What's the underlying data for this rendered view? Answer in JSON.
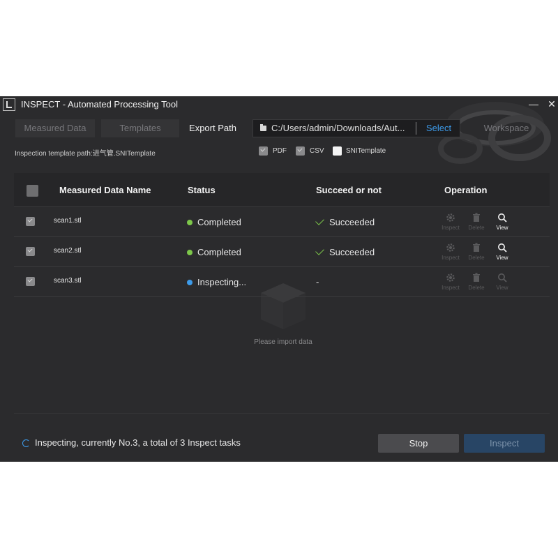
{
  "window": {
    "title": "INSPECT - Automated Processing Tool",
    "minimize_glyph": "—",
    "close_glyph": "✕"
  },
  "tabs": [
    {
      "label": "Measured Data",
      "active": false
    },
    {
      "label": "Templates",
      "active": false
    },
    {
      "label": "Export Path",
      "active": true
    },
    {
      "label": "Workspace",
      "active": false
    }
  ],
  "export": {
    "path_value": "C:/Users/admin/Downloads/Aut...",
    "select_label": "Select",
    "template_path_label": "Inspection template path:进气管.SNITemplate",
    "formats": [
      {
        "label": "PDF",
        "checked": true
      },
      {
        "label": "CSV",
        "checked": true
      },
      {
        "label": "SNITemplate",
        "checked": false
      }
    ]
  },
  "table": {
    "headers": {
      "name": "Measured Data Name",
      "status": "Status",
      "result": "Succeed or not",
      "operation": "Operation"
    },
    "rows": [
      {
        "name": "scan1.stl",
        "status": "Completed",
        "status_color": "#7dc74a",
        "result": "Succeeded",
        "view_enabled": true
      },
      {
        "name": "scan2.stl",
        "status": "Completed",
        "status_color": "#7dc74a",
        "result": "Succeeded",
        "view_enabled": true
      },
      {
        "name": "scan3.stl",
        "status": "Inspecting...",
        "status_color": "#3d9bea",
        "result": "-",
        "view_enabled": false
      }
    ],
    "operations": {
      "inspect": "Inspect",
      "delete": "Delete",
      "view": "View"
    },
    "empty_text": "Please import data"
  },
  "footer": {
    "progress_text": "Inspecting, currently No.3, a total of 3 Inspect tasks",
    "stop_label": "Stop",
    "inspect_label": "Inspect"
  },
  "colors": {
    "accent": "#3d9bea",
    "success": "#7dc74a",
    "background": "#2b2b2d"
  }
}
